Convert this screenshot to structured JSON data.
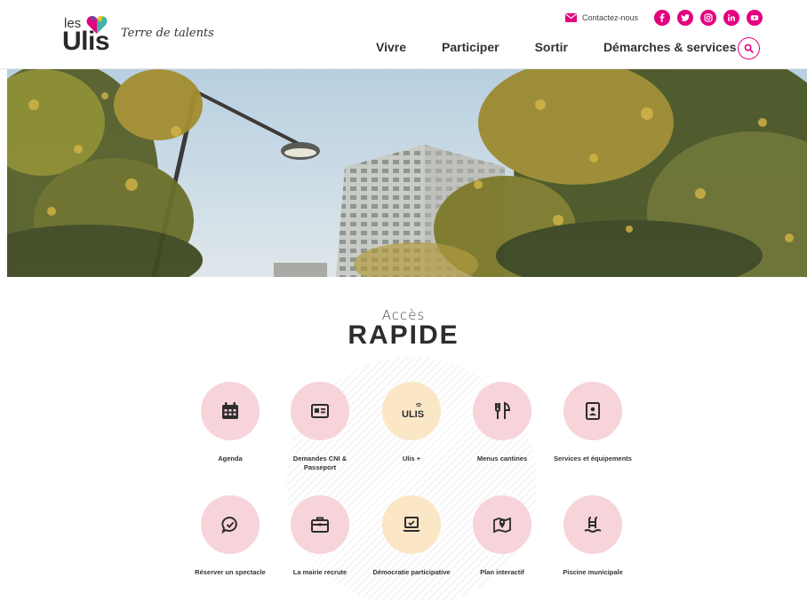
{
  "header": {
    "logo": {
      "small": "les",
      "big": "Ulis"
    },
    "tagline": "Terre de talents",
    "contact_label": "Contactez-nous",
    "social": [
      {
        "name": "facebook",
        "icon": "facebook-icon"
      },
      {
        "name": "twitter",
        "icon": "twitter-icon"
      },
      {
        "name": "instagram",
        "icon": "instagram-icon"
      },
      {
        "name": "linkedin",
        "icon": "linkedin-icon"
      },
      {
        "name": "youtube",
        "icon": "youtube-icon"
      }
    ],
    "nav": [
      "Vivre",
      "Participer",
      "Sortir",
      "Démarches & services"
    ],
    "search_icon": "search-icon"
  },
  "hero": {
    "description_icon": "hero-photo"
  },
  "quick_access": {
    "title_small": "Accès",
    "title_big": "RAPIDE",
    "items": [
      {
        "label": "Agenda",
        "icon": "calendar-icon",
        "color": "#f7d3da"
      },
      {
        "label": "Demandes CNI & Passeport",
        "icon": "id-card-icon",
        "color": "#f7d3da"
      },
      {
        "label": "Ulis +",
        "icon": "ulis-plus-icon",
        "icon_text": "ULIS",
        "color": "#fbe7c6"
      },
      {
        "label": "Menus cantines",
        "icon": "cutlery-icon",
        "color": "#f7d3da"
      },
      {
        "label": "Services et équipements",
        "icon": "directory-icon",
        "color": "#f7d3da"
      },
      {
        "label": "Réserver un spectacle",
        "icon": "chat-check-icon",
        "color": "#f7d3da"
      },
      {
        "label": "La mairie recrute",
        "icon": "briefcase-icon",
        "color": "#f7d3da"
      },
      {
        "label": "Démocratie participative",
        "icon": "laptop-check-icon",
        "color": "#fbe7c6"
      },
      {
        "label": "Plan interactif",
        "icon": "map-pin-icon",
        "color": "#f7d3da"
      },
      {
        "label": "Piscine municipale",
        "icon": "pool-icon",
        "color": "#f7d3da"
      }
    ]
  },
  "colors": {
    "accent": "#e4007e",
    "pink_tile": "#f7d3da",
    "cream_tile": "#fbe7c6"
  }
}
